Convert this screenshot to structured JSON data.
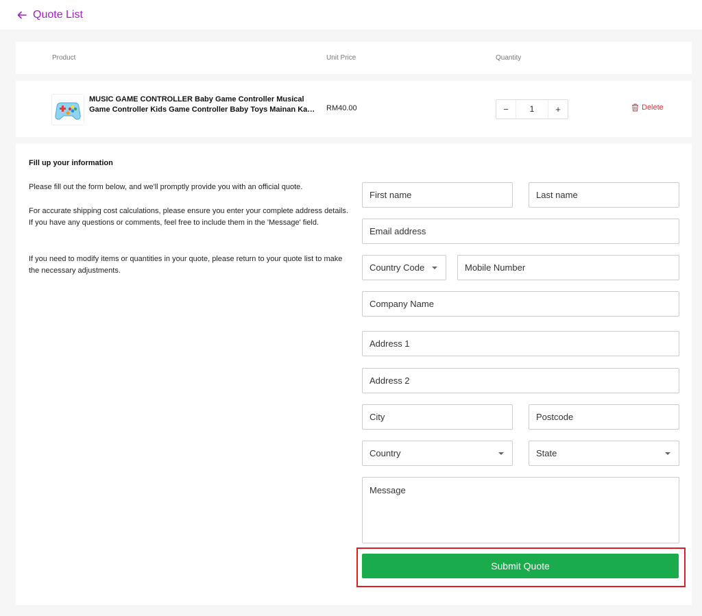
{
  "header": {
    "title": "Quote List",
    "back_icon": "arrow-left-icon",
    "accent": "#a31fc4"
  },
  "table": {
    "columns": [
      "Product",
      "Unit Price",
      "Quantity"
    ]
  },
  "items": [
    {
      "name_line1": "MUSIC GAME CONTROLLER Baby Game Controller Musical",
      "name_line2": "Game Controller Kids Game Controller Baby Toys Mainan Kanak Kanak Murah",
      "unit_price": "RM40.00",
      "quantity": "1",
      "decrement": "−",
      "increment": "+",
      "delete_label": "Delete",
      "delete_color": "#e03131"
    }
  ],
  "form": {
    "title": "Fill up your information",
    "intro": "Please fill out the form below, and we'll promptly provide you with an official quote.",
    "shipping_note": "For accurate shipping cost calculations, please ensure you enter your complete address details. If you have any questions or comments, feel free to include them in the 'Message' field.",
    "modify_note": "If you need to modify items or quantities in your quote, please return to your quote list to make the necessary adjustments.",
    "fields": {
      "first_name": "First name",
      "last_name": "Last name",
      "email": "Email address",
      "country_code": "Country Code",
      "mobile": "Mobile Number",
      "company": "Company Name",
      "address1": "Address 1",
      "address2": "Address 2",
      "city": "City",
      "postcode": "Postcode",
      "country": "Country",
      "state": "State",
      "message": "Message"
    },
    "submit_label": "Submit Quote",
    "submit_color": "#1aab4c"
  }
}
